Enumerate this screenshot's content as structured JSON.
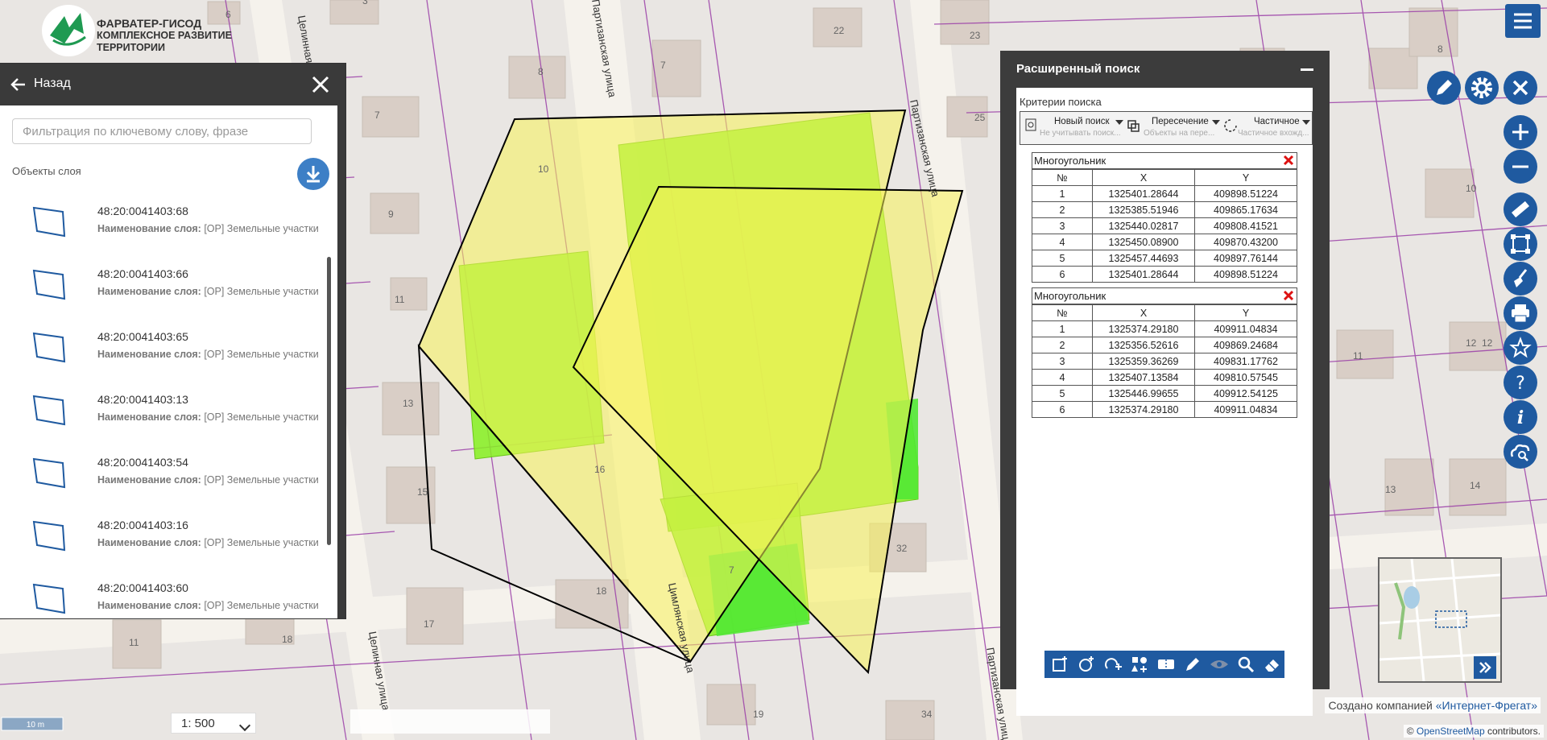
{
  "logo": {
    "line1": "ФАРВАТЕР-ГИСОД",
    "line2": "КОМПЛЕКСНОЕ РАЗВИТИЕ ТЕРРИТОРИИ"
  },
  "map": {
    "streets": [
      "Целинная улица",
      "Цимлянская улица",
      "Партизанская улица"
    ],
    "house_numbers": [
      "6",
      "3",
      "22",
      "23",
      "8",
      "7",
      "25",
      "8",
      "7",
      "10",
      "10",
      "9",
      "9",
      "11",
      "11",
      "12",
      "12",
      "13",
      "13",
      "14",
      "15",
      "16",
      "17",
      "18",
      "11",
      "18",
      "19",
      "32",
      "34",
      "7"
    ],
    "colors": {
      "selection_fill": "#f7f25a",
      "object_fill": "#8cf21e",
      "cadastre_line": "#9b3fa8"
    }
  },
  "left_panel": {
    "back_label": "Назад",
    "filter_placeholder": "Фильтрация по ключевому слову, фразе",
    "layer_title": "Объекты слоя",
    "sub_label": "Наименование слоя:",
    "items": [
      {
        "id": "48:20:0041403:68",
        "layer": "[ОР] Земельные участки"
      },
      {
        "id": "48:20:0041403:66",
        "layer": "[ОР] Земельные участки"
      },
      {
        "id": "48:20:0041403:65",
        "layer": "[ОР] Земельные участки"
      },
      {
        "id": "48:20:0041403:13",
        "layer": "[ОР] Земельные участки"
      },
      {
        "id": "48:20:0041403:54",
        "layer": "[ОР] Земельные участки"
      },
      {
        "id": "48:20:0041403:16",
        "layer": "[ОР] Земельные участки"
      },
      {
        "id": "48:20:0041403:60",
        "layer": "[ОР] Земельные участки"
      }
    ]
  },
  "adv_search": {
    "title": "Расширенный поиск",
    "criteria_label": "Критерии поиска",
    "tools": [
      {
        "main": "Новый поиск",
        "sub": "Не учитывать поиск..."
      },
      {
        "main": "Пересечение",
        "sub": "Объекты на пере..."
      },
      {
        "main": "Частичное",
        "sub": "Частичное вхожд..."
      }
    ],
    "col_no": "№",
    "col_x": "X",
    "col_y": "Y",
    "polygons": [
      {
        "label": "Многоугольник",
        "rows": [
          [
            "1",
            "1325401.28644",
            "409898.51224"
          ],
          [
            "2",
            "1325385.51946",
            "409865.17634"
          ],
          [
            "3",
            "1325440.02817",
            "409808.41521"
          ],
          [
            "4",
            "1325450.08900",
            "409870.43200"
          ],
          [
            "5",
            "1325457.44693",
            "409897.76144"
          ],
          [
            "6",
            "1325401.28644",
            "409898.51224"
          ]
        ]
      },
      {
        "label": "Многоугольник",
        "rows": [
          [
            "1",
            "1325374.29180",
            "409911.04834"
          ],
          [
            "2",
            "1325356.52616",
            "409869.24684"
          ],
          [
            "3",
            "1325359.36269",
            "409831.17762"
          ],
          [
            "4",
            "1325407.13584",
            "409810.57545"
          ],
          [
            "5",
            "1325446.99655",
            "409912.54125"
          ],
          [
            "6",
            "1325374.29180",
            "409911.04834"
          ]
        ]
      }
    ]
  },
  "bottom": {
    "scale_bar_label": "10 m",
    "scale_select": "1: 500",
    "credit_prefix": "Создано компанией ",
    "credit_link": "«Интернет-Фрегат»",
    "osm_prefix": "© ",
    "osm_link": "OpenStreetMap",
    "osm_suffix": " contributors."
  }
}
